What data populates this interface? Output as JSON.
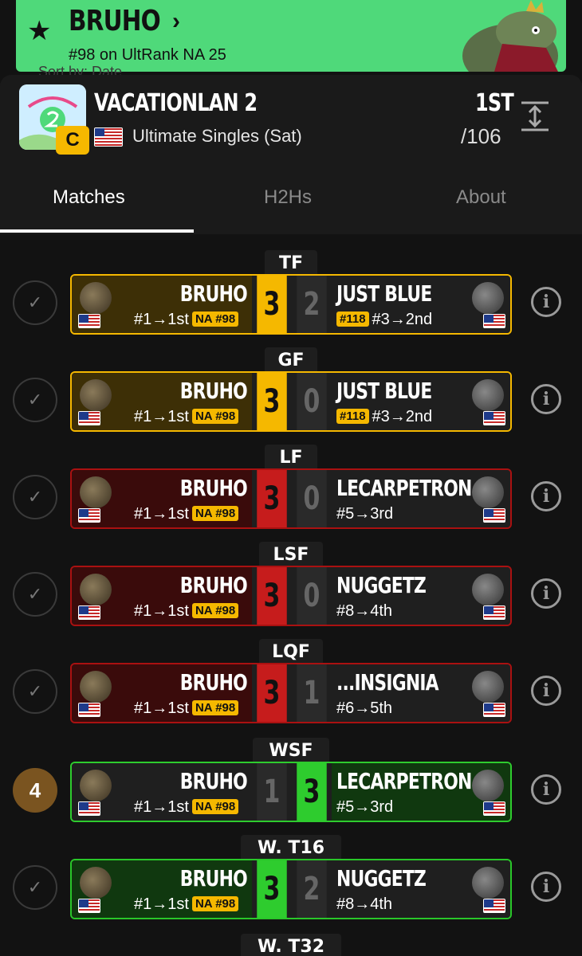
{
  "player": {
    "name": "BRUHO",
    "ranking": "#98 on UltRank NA 25",
    "favorite_icon": "star-icon"
  },
  "ghost_text": "Sort by: Date",
  "event": {
    "title": "VACATIONLAN 2",
    "tier": "C",
    "subtitle": "Ultimate Singles (Sat)",
    "placement": "1ST",
    "entrants": "/106"
  },
  "tabs": [
    "Matches",
    "H2Hs",
    "About"
  ],
  "sets": [
    {
      "round": "TF",
      "theme": "gold",
      "p1": "BRUHO",
      "p1_seed": "#1→1st",
      "p1_badge": "NA #98",
      "s1": "3",
      "s2": "2",
      "p2": "JUST BLUE",
      "p2_badge": "#118",
      "p2_seed": "#3→2nd",
      "status": "✓"
    },
    {
      "round": "GF",
      "theme": "gold",
      "p1": "BRUHO",
      "p1_seed": "#1→1st",
      "p1_badge": "NA #98",
      "s1": "3",
      "s2": "0",
      "p2": "JUST BLUE",
      "p2_badge": "#118",
      "p2_seed": "#3→2nd",
      "status": "✓"
    },
    {
      "round": "LF",
      "theme": "red",
      "p1": "BRUHO",
      "p1_seed": "#1→1st",
      "p1_badge": "NA #98",
      "s1": "3",
      "s2": "0",
      "p2": "LECARPETRON",
      "p2_badge": "",
      "p2_seed": "#5→3rd",
      "status": "✓"
    },
    {
      "round": "LSF",
      "theme": "red",
      "p1": "BRUHO",
      "p1_seed": "#1→1st",
      "p1_badge": "NA #98",
      "s1": "3",
      "s2": "0",
      "p2": "NUGGETZ",
      "p2_badge": "",
      "p2_seed": "#8→4th",
      "status": "✓"
    },
    {
      "round": "LQF",
      "theme": "red",
      "p1": "BRUHO",
      "p1_seed": "#1→1st",
      "p1_badge": "NA #98",
      "s1": "3",
      "s2": "1",
      "p2": "...INSIGNIA",
      "p2_badge": "",
      "p2_seed": "#6→5th",
      "status": "✓"
    },
    {
      "round": "WSF",
      "theme": "loss",
      "p1": "BRUHO",
      "p1_seed": "#1→1st",
      "p1_badge": "NA #98",
      "s1": "1",
      "s2": "3",
      "p2": "LECARPETRON",
      "p2_badge": "",
      "p2_seed": "#5→3rd",
      "status": "4"
    },
    {
      "round": "W. T16",
      "theme": "greenw",
      "p1": "BRUHO",
      "p1_seed": "#1→1st",
      "p1_badge": "NA #98",
      "s1": "3",
      "s2": "2",
      "p2": "NUGGETZ",
      "p2_badge": "",
      "p2_seed": "#8→4th",
      "status": "✓"
    }
  ],
  "next_round": "W. T32",
  "colors": {
    "banner": "#4fd97a",
    "gold": "#f5b800",
    "red": "#c61c1c",
    "green": "#2ecc2e"
  }
}
